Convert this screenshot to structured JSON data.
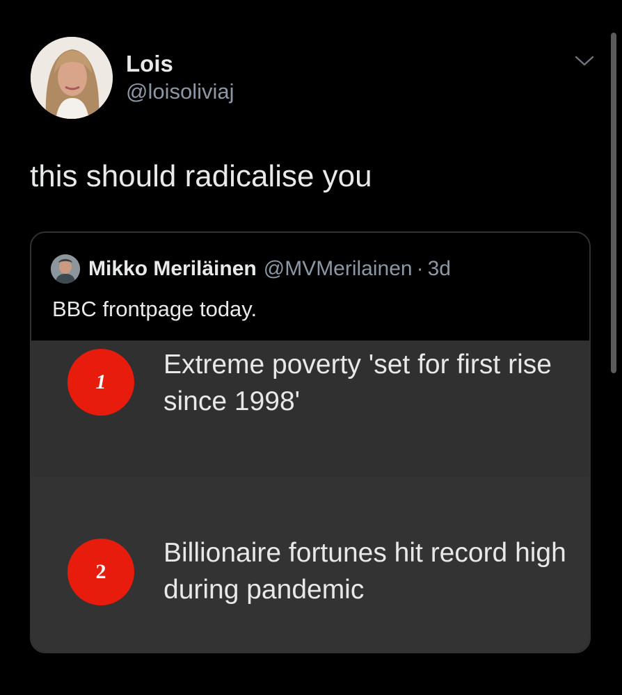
{
  "tweet": {
    "author_name": "Lois",
    "author_handle": "@loisoliviaj",
    "text": "this should radicalise you",
    "menu_icon": "chevron-down-icon"
  },
  "quote": {
    "author_name": "Mikko Meriläinen",
    "author_handle": "@MVMerilainen",
    "separator": "·",
    "time": "3d",
    "text": "BBC frontpage today.",
    "image": {
      "stories": [
        {
          "rank": "1",
          "headline": "Extreme poverty 'set for first rise since 1998'"
        },
        {
          "rank": "2",
          "headline": "Billionaire fortunes hit record high during pandemic"
        }
      ]
    }
  },
  "colors": {
    "background": "#000000",
    "primary_text": "#e7e9ea",
    "secondary_text": "#8b98a5",
    "card_border": "#2f3336",
    "rank_badge": "#e81c0d",
    "story_background": "#303030"
  }
}
